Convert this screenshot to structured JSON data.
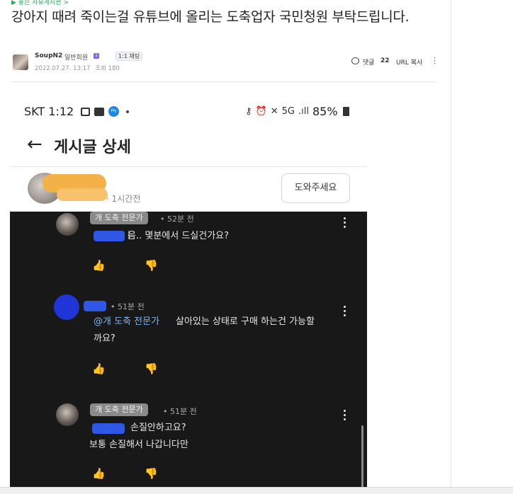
{
  "board_link": "▶ 좋은 사유게시판 >",
  "post": {
    "title": "강아지 때려 죽이는걸 유튜브에 올리는 도축업자 국민청원 부탁드립니다.",
    "author": "SoupN2",
    "author_grade": "일반회원",
    "level_badge": "1",
    "chat_badge": "1:1 채팅",
    "date": "2022.07.27. 13:17",
    "views_label": "조회 180",
    "comment_label": "댓글",
    "comment_count": "22",
    "url_copy_label": "URL 복사",
    "more_icon": "⋮"
  },
  "screenshot": {
    "status_bar": {
      "carrier_time": "SKT 1:12",
      "battery": "85%",
      "signal": ".ıll",
      "network": "5G"
    },
    "app_bar": {
      "back_icon": "←",
      "title": "게시글 상세"
    },
    "post_header": {
      "time": "· 1시간전",
      "help_button": "도와주세요"
    },
    "comments": [
      {
        "chip": "개 도축 전문가",
        "time": "• 52분 전",
        "suffix": "ㅣ",
        "text": "음.. 몇분에서 드실건가요?"
      },
      {
        "chip": "",
        "time": "• 51분 전",
        "mention": "@개 도축 전문가",
        "text": "살아있는 상태로 구매 하는건 가능할",
        "text2": "까요?"
      },
      {
        "chip": "개 도축 전문가",
        "time": "• 51분 전",
        "text": "손질안하고요?",
        "text2": "보통 손질해서 나갑니다만"
      }
    ],
    "like_icon": "👍",
    "dislike_icon": "👎"
  }
}
